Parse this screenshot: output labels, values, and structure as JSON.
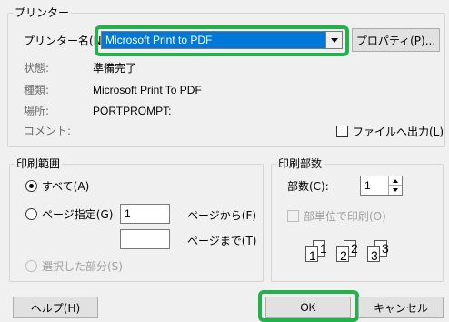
{
  "printer": {
    "group_label": "プリンター",
    "name_label": "プリンター名(N):",
    "name_value": "Microsoft Print to PDF",
    "properties_button": "プロパティ(P)...",
    "status_label": "状態:",
    "status_value": "準備完了",
    "type_label": "種類:",
    "type_value": "Microsoft Print To PDF",
    "location_label": "場所:",
    "location_value": "PORTPROMPT:",
    "comment_label": "コメント:",
    "print_to_file_label": "ファイルへ出力(L)"
  },
  "range": {
    "group_label": "印刷範囲",
    "all_label": "すべて(A)",
    "pages_label": "ページ指定(G)",
    "from_value": "1",
    "to_value": "",
    "from_label": "ページから(F)",
    "to_label": "ページまで(T)",
    "selection_label": "選択した部分(S)"
  },
  "copies": {
    "group_label": "印刷部数",
    "count_label": "部数(C):",
    "count_value": "1",
    "collate_label": "部単位で印刷(O)",
    "collate_pages": [
      "1",
      "1",
      "2",
      "2",
      "3",
      "3"
    ]
  },
  "footer": {
    "help_button": "ヘルプ(H)",
    "ok_button": "OK",
    "cancel_button": "キャンセル"
  },
  "colors": {
    "highlight": "#22b14c",
    "selection": "#0078d7"
  }
}
